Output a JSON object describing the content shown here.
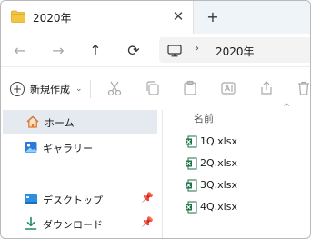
{
  "tab": {
    "title": "2020年",
    "close_glyph": "✕"
  },
  "newtab_glyph": "+",
  "nav": {
    "back": "←",
    "forward": "→",
    "up": "↑",
    "refresh": "⟳"
  },
  "address": {
    "separator": "›",
    "crumb": "2020年"
  },
  "command": {
    "new_label": "新規作成",
    "new_chevron": "⌄"
  },
  "sidebar": {
    "items": [
      {
        "label": "ホーム",
        "icon": "home-icon",
        "selected": true
      },
      {
        "label": "ギャラリー",
        "icon": "gallery-icon",
        "selected": false
      },
      {
        "label": "デスクトップ",
        "icon": "desktop-icon",
        "pinned": true
      },
      {
        "label": "ダウンロード",
        "icon": "download-icon",
        "pinned": true
      }
    ]
  },
  "files": {
    "column_name": "名前",
    "sort_glyph": "^",
    "items": [
      {
        "name": "1Q.xlsx"
      },
      {
        "name": "2Q.xlsx"
      },
      {
        "name": "3Q.xlsx"
      },
      {
        "name": "4Q.xlsx"
      }
    ]
  },
  "pin_glyph": "📌",
  "colors": {
    "folder": "#f4c542",
    "excel": "#1e7145",
    "selected_bg": "#e5eaf0",
    "accent": "#0067c0"
  }
}
